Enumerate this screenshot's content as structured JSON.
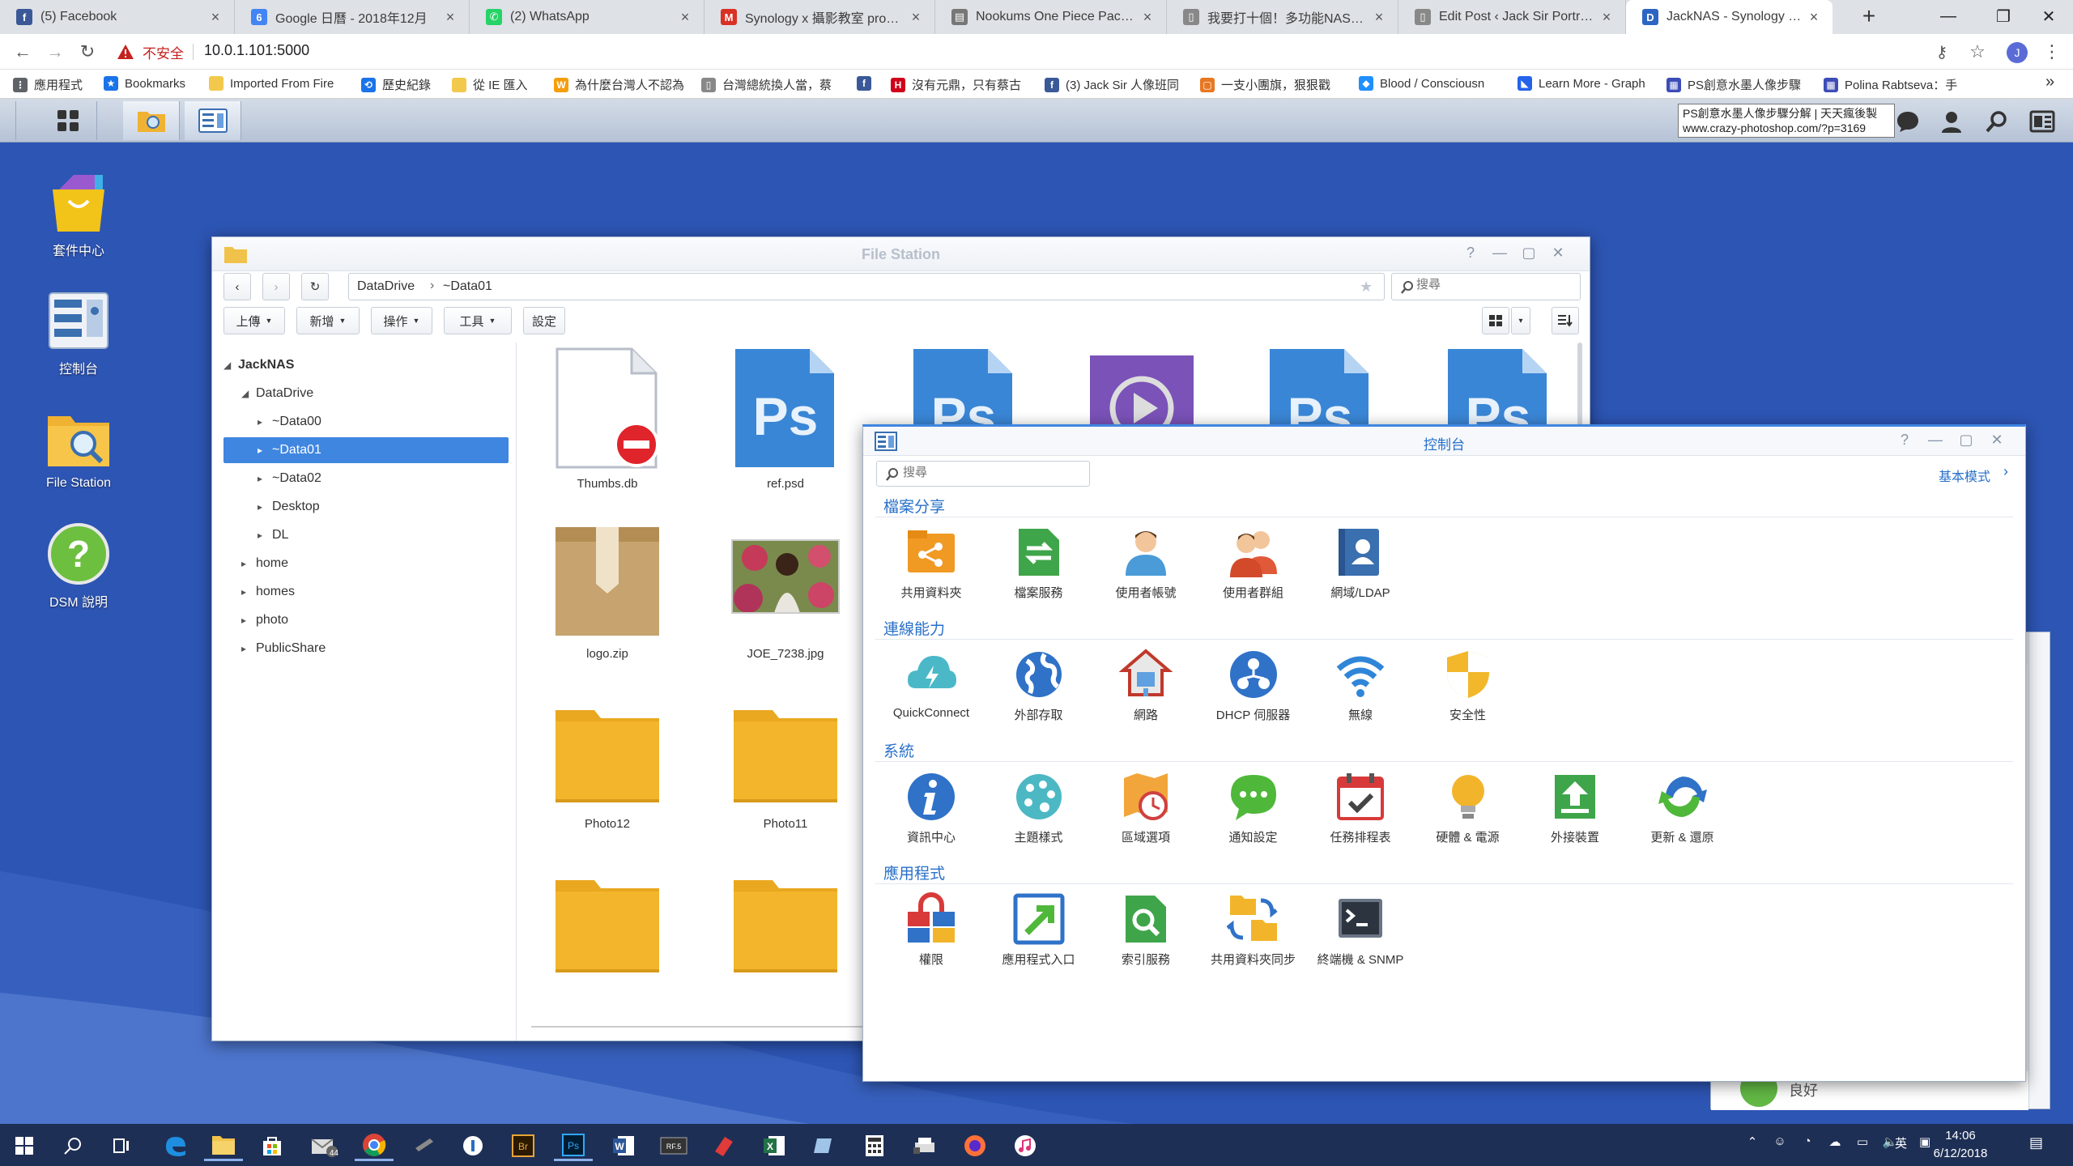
{
  "browser": {
    "tabs": [
      {
        "title": "(5) Facebook",
        "icon": "facebook-icon",
        "color": "#3b5998",
        "glyph": "f"
      },
      {
        "title": "Google 日曆 - 2018年12月",
        "icon": "calendar-icon",
        "color": "#4285f4",
        "glyph": "6"
      },
      {
        "title": "(2) WhatsApp",
        "icon": "whatsapp-icon",
        "color": "#25d366",
        "glyph": "✆"
      },
      {
        "title": "Synology x 攝影教室 product",
        "icon": "gmail-icon",
        "color": "#d93025",
        "glyph": "M"
      },
      {
        "title": "Nookums One Piece Pacifier",
        "icon": "page-icon",
        "color": "#777777",
        "glyph": "▤"
      },
      {
        "title": "我要打十個！多功能NAS – Sy",
        "icon": "document-icon",
        "color": "#888888",
        "glyph": "▯"
      },
      {
        "title": "Edit Post ‹ Jack Sir Portrait Ph",
        "icon": "document-icon",
        "color": "#888888",
        "glyph": "▯"
      },
      {
        "title": "JackNAS - Synology DiskStat",
        "icon": "dsm-icon",
        "color": "#2d65c4",
        "glyph": "D"
      }
    ],
    "security_label": "不安全",
    "url": "10.0.1.101:5000",
    "account_initial": "J",
    "bookmarks": [
      {
        "label": "應用程式",
        "icon": "apps-icon",
        "color": "#5f6368",
        "glyph": "⋮"
      },
      {
        "label": "Bookmarks",
        "icon": "star-icon",
        "color": "#1a73e8",
        "glyph": "★"
      },
      {
        "label": "Imported From Fire",
        "icon": "folder-icon",
        "color": "#f2c94c",
        "glyph": ""
      },
      {
        "label": "歷史紀錄",
        "icon": "history-icon",
        "color": "#1a73e8",
        "glyph": "⟲"
      },
      {
        "label": "從 IE 匯入",
        "icon": "folder-icon",
        "color": "#f2c94c",
        "glyph": ""
      },
      {
        "label": "為什麼台灣人不認為",
        "icon": "w-icon",
        "color": "#f59e0b",
        "glyph": "W"
      },
      {
        "label": "台灣總統換人當，蔡",
        "icon": "page-icon",
        "color": "#888888",
        "glyph": "▯"
      },
      {
        "label": "",
        "icon": "facebook-icon",
        "color": "#3b5998",
        "glyph": "f"
      },
      {
        "label": "沒有元鼎，只有蔡古",
        "icon": "h-icon",
        "color": "#d0021b",
        "glyph": "H"
      },
      {
        "label": "(3) Jack Sir 人像班同",
        "icon": "facebook-icon",
        "color": "#3b5998",
        "glyph": "f"
      },
      {
        "label": "一支小團旗，狠狠戳",
        "icon": "page-icon",
        "color": "#e87722",
        "glyph": "▢"
      },
      {
        "label": "Blood / Consciousn",
        "icon": "chat-icon",
        "color": "#1f8fff",
        "glyph": "◆"
      },
      {
        "label": "Learn More - Graph",
        "icon": "graph-icon",
        "color": "#2563eb",
        "glyph": "◣"
      },
      {
        "label": "PS創意水墨人像步驟",
        "icon": "site-icon",
        "color": "#3d4db7",
        "glyph": "▦"
      },
      {
        "label": "Polina Rabtseva：手",
        "icon": "site-icon",
        "color": "#3d4db7",
        "glyph": "▦"
      }
    ],
    "bookmarks_more": "»"
  },
  "dsm": {
    "tooltip": [
      "PS創意水墨人像步驟分解 | 天天瘋後製",
      "www.crazy-photoshop.com/?p=3169"
    ],
    "desktop_icons": [
      {
        "label": "套件中心",
        "icon": "package-center-icon"
      },
      {
        "label": "控制台",
        "icon": "control-panel-icon"
      },
      {
        "label": "File Station",
        "icon": "file-station-icon"
      },
      {
        "label": "DSM 說明",
        "icon": "help-icon"
      }
    ],
    "bg_widget_text": "良好"
  },
  "file_station": {
    "title": "File Station",
    "path": [
      "DataDrive",
      "~Data01"
    ],
    "search_placeholder": "搜尋",
    "toolbar": [
      "上傳",
      "新增",
      "操作",
      "工具",
      "設定"
    ],
    "tree": [
      {
        "label": "JackNAS",
        "level": 0,
        "expanded": true,
        "bold": true
      },
      {
        "label": "DataDrive",
        "level": 1,
        "expanded": true
      },
      {
        "label": "~Data00",
        "level": 2
      },
      {
        "label": "~Data01",
        "level": 2,
        "selected": true
      },
      {
        "label": "~Data02",
        "level": 2
      },
      {
        "label": "Desktop",
        "level": 2
      },
      {
        "label": "DL",
        "level": 2
      },
      {
        "label": "home",
        "level": 1
      },
      {
        "label": "homes",
        "level": 1
      },
      {
        "label": "photo",
        "level": 1
      },
      {
        "label": "PublicShare",
        "level": 1
      }
    ],
    "files": [
      {
        "name": "Thumbs.db",
        "type": "blocked"
      },
      {
        "name": "ref.psd",
        "type": "psd"
      },
      {
        "name": "",
        "type": "psd"
      },
      {
        "name": "",
        "type": "video"
      },
      {
        "name": "",
        "type": "psd"
      },
      {
        "name": "",
        "type": "psd"
      },
      {
        "name": "logo.zip",
        "type": "zip"
      },
      {
        "name": "JOE_7238.jpg",
        "type": "photo"
      },
      {
        "name": "Photo12",
        "type": "folder"
      },
      {
        "name": "Photo11",
        "type": "folder"
      },
      {
        "name": "",
        "type": "folder"
      },
      {
        "name": "",
        "type": "folder"
      }
    ]
  },
  "control_panel": {
    "title": "控制台",
    "search_placeholder": "搜尋",
    "mode_link": "基本模式",
    "sections": [
      {
        "title": "檔案分享",
        "items": [
          {
            "label": "共用資料夾",
            "icon": "shared-folder-icon"
          },
          {
            "label": "檔案服務",
            "icon": "file-services-icon"
          },
          {
            "label": "使用者帳號",
            "icon": "user-icon"
          },
          {
            "label": "使用者群組",
            "icon": "group-icon"
          },
          {
            "label": "網域/LDAP",
            "icon": "ldap-icon"
          }
        ]
      },
      {
        "title": "連線能力",
        "items": [
          {
            "label": "QuickConnect",
            "icon": "quickconnect-icon"
          },
          {
            "label": "外部存取",
            "icon": "external-access-icon"
          },
          {
            "label": "網路",
            "icon": "network-icon"
          },
          {
            "label": "DHCP 伺服器",
            "icon": "dhcp-icon"
          },
          {
            "label": "無線",
            "icon": "wireless-icon"
          },
          {
            "label": "安全性",
            "icon": "security-icon"
          }
        ]
      },
      {
        "title": "系統",
        "items": [
          {
            "label": "資訊中心",
            "icon": "info-icon"
          },
          {
            "label": "主題樣式",
            "icon": "theme-icon"
          },
          {
            "label": "區域選項",
            "icon": "regional-icon"
          },
          {
            "label": "通知設定",
            "icon": "notification-icon"
          },
          {
            "label": "任務排程表",
            "icon": "task-scheduler-icon"
          },
          {
            "label": "硬體 & 電源",
            "icon": "hardware-icon"
          },
          {
            "label": "外接裝置",
            "icon": "external-device-icon"
          },
          {
            "label": "更新 & 還原",
            "icon": "update-icon"
          }
        ]
      },
      {
        "title": "應用程式",
        "items": [
          {
            "label": "權限",
            "icon": "privileges-icon"
          },
          {
            "label": "應用程式入口",
            "icon": "app-portal-icon"
          },
          {
            "label": "索引服務",
            "icon": "indexing-icon"
          },
          {
            "label": "共用資料夾同步",
            "icon": "folder-sync-icon"
          },
          {
            "label": "終端機 & SNMP",
            "icon": "terminal-icon"
          }
        ]
      }
    ]
  },
  "taskbar": {
    "apps": [
      "windows-start-icon",
      "search-icon",
      "task-view-icon",
      "edge-icon",
      "explorer-icon",
      "store-icon",
      "mail-icon",
      "chrome-icon",
      "tool-icon",
      "app-1-icon",
      "bridge-icon",
      "photoshop-icon",
      "word-icon",
      "raw-icon",
      "app-red-icon",
      "excel-icon",
      "app-blue-icon",
      "calculator-icon",
      "printer-icon",
      "firefox-icon",
      "itunes-icon"
    ],
    "labels": {
      "bridge": "Br",
      "photoshop": "Ps",
      "word": "W",
      "excel": "X",
      "raw": "RF.5",
      "mail_badge": "44"
    },
    "ime": "英",
    "time": "14:06",
    "date": "6/12/2018"
  }
}
